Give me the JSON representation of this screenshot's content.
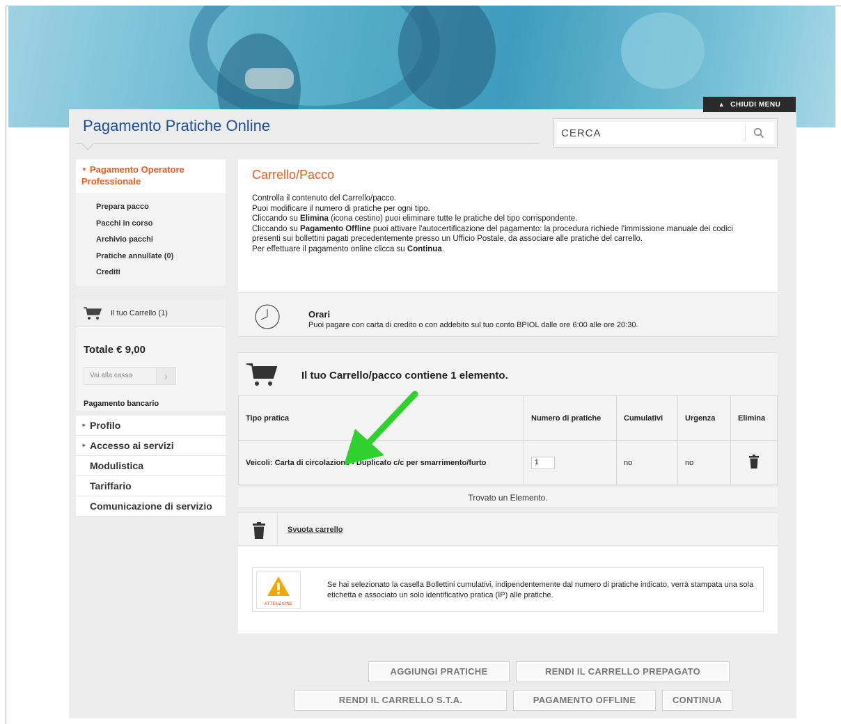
{
  "header": {
    "menu_toggle": "CHIUDI MENU",
    "site_title": "Pagamento Pratiche Online",
    "search_placeholder": "CERCA"
  },
  "sidebar": {
    "section_title": "Pagamento Operatore Professionale",
    "items": [
      {
        "label": "Prepara pacco"
      },
      {
        "label": "Pacchi in corso"
      },
      {
        "label": "Archivio pacchi"
      },
      {
        "label": "Pratiche annullate (0)"
      },
      {
        "label": "Crediti"
      }
    ],
    "cart_label": "Il tuo Carrello (1)",
    "total": "Totale € 9,00",
    "checkout_label": "Vai alla cassa",
    "bank_payment": "Pagamento bancario",
    "links": [
      {
        "label": "Profilo",
        "expandable": true
      },
      {
        "label": "Accesso ai servizi",
        "expandable": true
      },
      {
        "label": "Modulistica",
        "expandable": false
      },
      {
        "label": "Tariffario",
        "expandable": false
      },
      {
        "label": "Comunicazione di servizio",
        "expandable": false
      }
    ]
  },
  "main": {
    "title": "Carrello/Pacco",
    "intro": {
      "line1": "Controlla il contenuto del Carrello/pacco.",
      "line2": "Puoi modificare il numero di pratiche per ogni tipo.",
      "line3_pre": "Cliccando su ",
      "line3_bold": "Elimina",
      "line3_post": " (icona cestino) puoi eliminare tutte le pratiche del tipo corrispondente.",
      "line4_pre": "Cliccando su ",
      "line4_bold": "Pagamento Offline",
      "line4_post": " puoi attivare l'autocertificazione del pagamento: la procedura richiede l'immissione manuale dei codici presenti sui bollettini pagati precedentemente presso un Ufficio Postale, da associare alle pratiche del carrello.",
      "line5_pre": "Per effettuare il pagamento online clicca su ",
      "line5_bold": "Continua",
      "line5_post": "."
    },
    "orari": {
      "title": "Orari",
      "text": "Puoi pagare con carta di credito o con addebito sul tuo conto BPIOL dalle ore 6:00 alle ore 20:30."
    },
    "cart_message": "Il tuo Carrello/pacco contiene 1 elemento.",
    "table": {
      "headers": {
        "tipo": "Tipo pratica",
        "numero": "Numero di pratiche",
        "cumulativi": "Cumulativi",
        "urgenza": "Urgenza",
        "elimina": "Elimina"
      },
      "row": {
        "tipo": "Veicoli: Carta di circolazione - Duplicato c/c per smarrimento/furto",
        "numero": "1",
        "cumulativi": "no",
        "urgenza": "no"
      }
    },
    "found": "Trovato un Elemento.",
    "empty_cart": "Svuota carrello",
    "warning": {
      "icon_label": "ATTENZIONE",
      "text": "Se hai selezionato la casella Bollettini cumulativi, indipendentemente dal numero di pratiche indicato, verrà stampata una sola etichetta e associato un solo identificativo pratica (IP) alle pratiche."
    },
    "buttons": {
      "aggiungi": "AGGIUNGI PRATICHE",
      "prepagato": "RENDI IL CARRELLO PREPAGATO",
      "sta": "RENDI IL CARRELLO S.T.A.",
      "offline": "PAGAMENTO OFFLINE",
      "continua": "CONTINUA"
    }
  },
  "colors": {
    "accent": "#f05a1e",
    "title_blue": "#1d4e9a",
    "arrow_green": "#2fd12f"
  }
}
